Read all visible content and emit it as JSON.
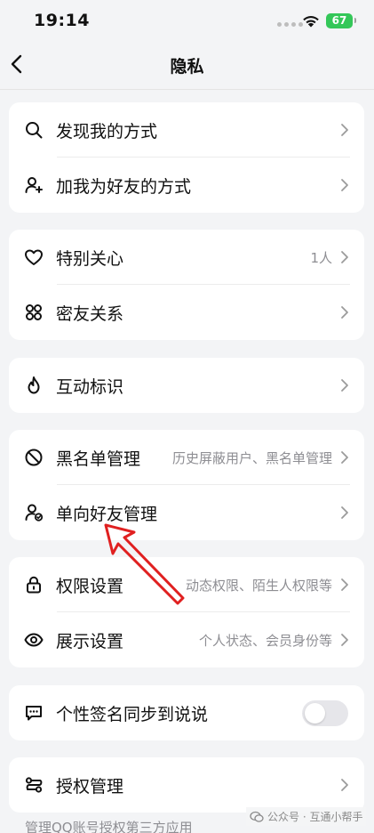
{
  "status_bar": {
    "time": "19:14",
    "battery": "67"
  },
  "nav": {
    "title": "隐私"
  },
  "groups": [
    {
      "rows": [
        {
          "icon": "search-icon",
          "label": "发现我的方式",
          "value": ""
        },
        {
          "icon": "add-user-icon",
          "label": "加我为好友的方式",
          "value": ""
        }
      ]
    },
    {
      "rows": [
        {
          "icon": "heart-icon",
          "label": "特别关心",
          "value": "1人"
        },
        {
          "icon": "close-friends-icon",
          "label": "密友关系",
          "value": ""
        }
      ]
    },
    {
      "rows": [
        {
          "icon": "flame-icon",
          "label": "互动标识",
          "value": ""
        }
      ]
    },
    {
      "rows": [
        {
          "icon": "block-icon",
          "label": "黑名单管理",
          "value": "历史屏蔽用户、黑名单管理"
        },
        {
          "icon": "one-way-friend-icon",
          "label": "单向好友管理",
          "value": ""
        }
      ]
    },
    {
      "rows": [
        {
          "icon": "lock-icon",
          "label": "权限设置",
          "value": "动态权限、陌生人权限等"
        },
        {
          "icon": "eye-icon",
          "label": "展示设置",
          "value": "个人状态、会员身份等"
        }
      ]
    },
    {
      "rows": [
        {
          "icon": "chat-sync-icon",
          "label": "个性签名同步到说说",
          "value": "",
          "toggle": false
        }
      ]
    },
    {
      "rows": [
        {
          "icon": "authorization-icon",
          "label": "授权管理",
          "value": ""
        }
      ]
    }
  ],
  "footer": {
    "note": "管理QQ账号授权第三方应用"
  },
  "watermark": {
    "text": "公众号 · 互通小帮手"
  },
  "colors": {
    "annotation_arrow": "#e02020",
    "toggle_off": "#e6e6ea",
    "battery": "#34c759"
  }
}
